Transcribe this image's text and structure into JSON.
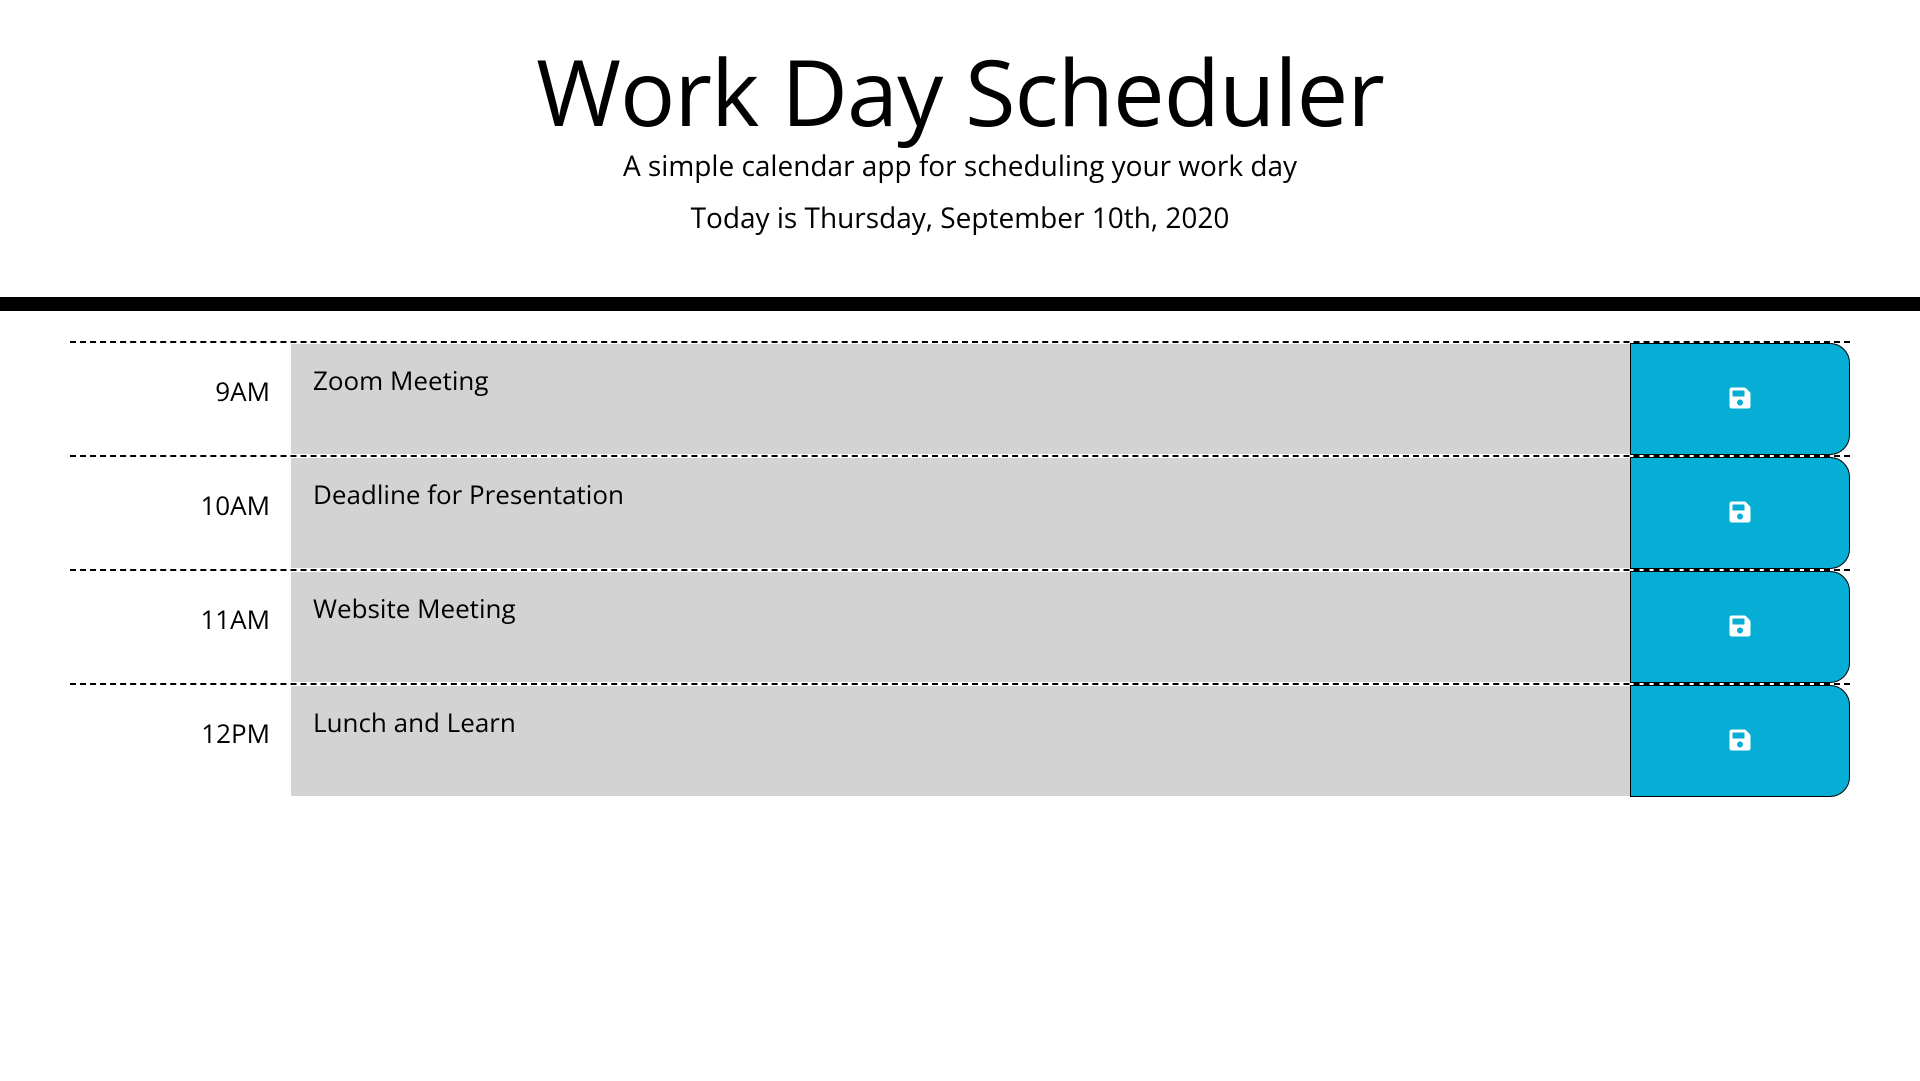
{
  "header": {
    "title": "Work Day Scheduler",
    "subtitle": "A simple calendar app for scheduling your work day",
    "date_prefix": "Today is ",
    "date": "Thursday, September 10th, 2020"
  },
  "icons": {
    "save": "save-icon"
  },
  "colors": {
    "save_button": "#06aed5",
    "past_block": "#d3d3d3"
  },
  "time_blocks": [
    {
      "hour_label": "9AM",
      "value": "Zoom Meeting"
    },
    {
      "hour_label": "10AM",
      "value": "Deadline for Presentation"
    },
    {
      "hour_label": "11AM",
      "value": "Website Meeting"
    },
    {
      "hour_label": "12PM",
      "value": "Lunch and Learn"
    }
  ]
}
